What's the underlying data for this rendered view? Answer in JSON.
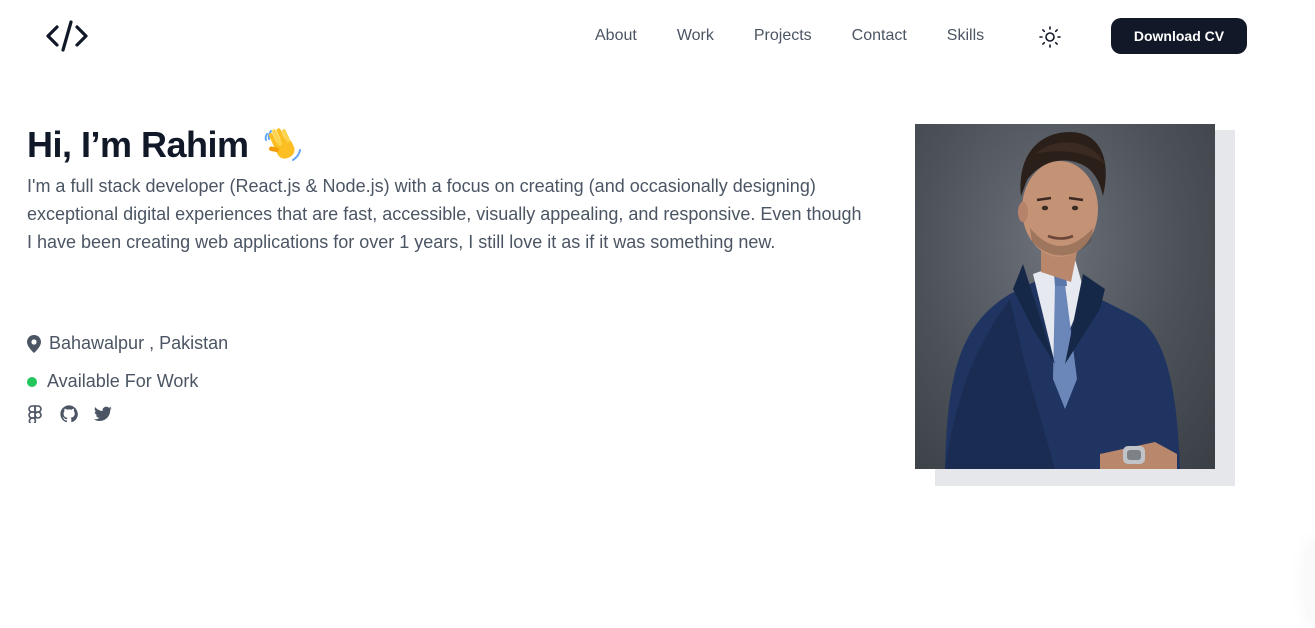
{
  "nav": {
    "links": [
      {
        "label": "About"
      },
      {
        "label": "Work"
      },
      {
        "label": "Projects"
      },
      {
        "label": "Contact"
      },
      {
        "label": "Skills"
      }
    ],
    "theme_icon": "sun-icon",
    "cv_button": "Download CV",
    "logo_icon": "code-brackets-icon"
  },
  "hero": {
    "title": "Hi, I’m Rahim",
    "wave_icon": "waving-hand-icon",
    "bio": "I'm a full stack developer (React.js & Node.js) with a focus on creating (and occasionally designing) exceptional digital experiences that are fast, accessible, visually appealing, and responsive. Even though I have been creating web applications for over 1 years, I still love it as if it was something new.",
    "location": "Bahawalpur , Pakistan",
    "status": "Available For Work",
    "socials": [
      {
        "icon": "figma-icon"
      },
      {
        "icon": "github-icon"
      },
      {
        "icon": "twitter-icon"
      }
    ]
  },
  "colors": {
    "primary_dark": "#111827",
    "text_gray": "#4b5563",
    "available_green": "#22c55e",
    "photo_shadow": "#e5e7eb"
  }
}
